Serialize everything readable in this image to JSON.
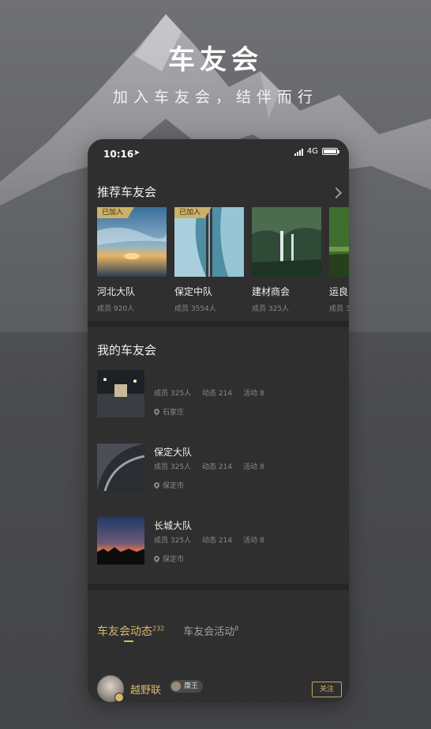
{
  "hero": {
    "title": "车友会",
    "subtitle": "加入车友会，结伴而行"
  },
  "status_bar": {
    "time": "10:16",
    "network": "4G"
  },
  "recommended": {
    "heading": "推荐车友会",
    "cards": [
      {
        "name": "河北大队",
        "meta": "成员 920人",
        "tag": "已加入"
      },
      {
        "name": "保定中队",
        "meta": "成员 3554人",
        "tag": "已加入"
      },
      {
        "name": "建材商会",
        "meta": "成员 325人",
        "tag": ""
      },
      {
        "name": "运良",
        "meta": "成员 3",
        "tag": ""
      }
    ]
  },
  "my_clubs": {
    "heading": "我的车友会",
    "items": [
      {
        "name": "",
        "members": "成员 325人",
        "posts": "动态 214",
        "events": "活动 8",
        "city": "石家庄"
      },
      {
        "name": "保定大队",
        "members": "成员 325人",
        "posts": "动态 214",
        "events": "活动 8",
        "city": "保定市"
      },
      {
        "name": "长城大队",
        "members": "成员 325人",
        "posts": "动态 214",
        "events": "活动 8",
        "city": "保定市"
      }
    ]
  },
  "tabs": [
    {
      "label": "车友会动态",
      "count": "232"
    },
    {
      "label": "车友会活动",
      "count": "8"
    }
  ],
  "post": {
    "author": "越野联",
    "badge": "康王",
    "follow_label": "关注"
  },
  "colors": {
    "accent": "#d8b76b",
    "card_bg": "#2f2f30",
    "tag_bg": "#cdb06a"
  }
}
